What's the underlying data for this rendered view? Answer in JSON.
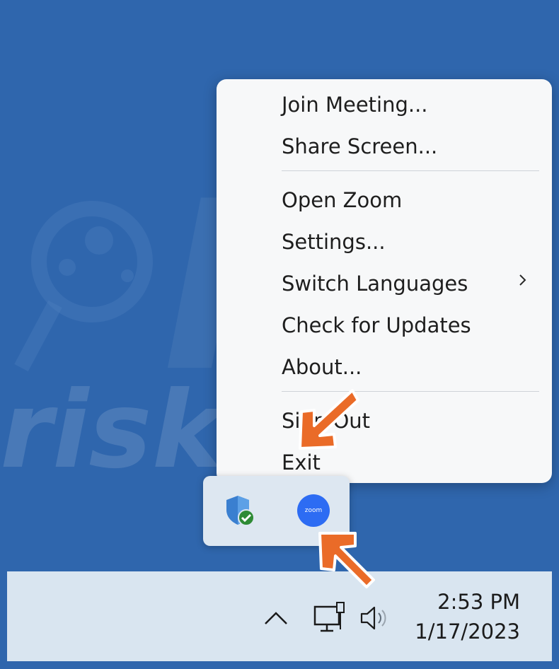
{
  "context_menu": {
    "join_meeting": "Join Meeting...",
    "share_screen": "Share Screen...",
    "open_zoom": "Open Zoom",
    "settings": "Settings...",
    "switch_languages": "Switch Languages",
    "check_updates": "Check for Updates",
    "about": "About...",
    "sign_out": "Sign Out",
    "exit": "Exit"
  },
  "tray_flyout": {
    "icons": [
      "windows-security-icon",
      "zoom-icon"
    ],
    "zoom_badge_text": "zoom"
  },
  "taskbar": {
    "time": "2:53 PM",
    "date": "1/17/2023",
    "icons": [
      "chevron-up-icon",
      "network-icon",
      "volume-icon"
    ]
  },
  "watermark": {
    "text": "risk.com"
  },
  "colors": {
    "desktop": "#2f66ad",
    "menu_bg": "#f7f8f9",
    "taskbar_bg": "#d9e5f0",
    "arrow": "#ea6b28",
    "zoom_blue": "#2d6cf3",
    "security_green": "#2e8b35"
  }
}
